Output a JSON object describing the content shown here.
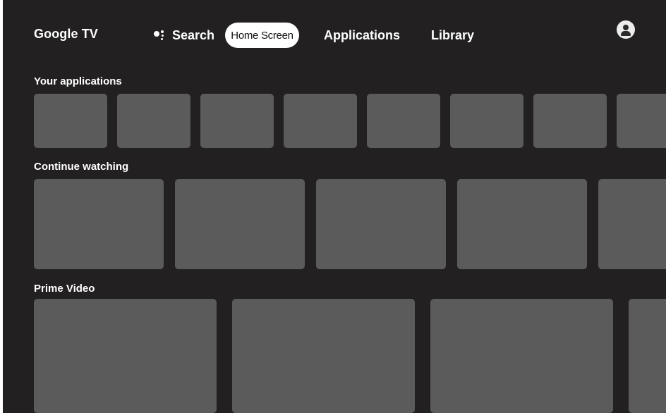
{
  "app": {
    "title": "Google TV"
  },
  "nav": {
    "search_label": "Search",
    "home_label": "Home Screen",
    "applications_label": "Applications",
    "library_label": "Library",
    "search_icon": "google-assistant-icon",
    "profile_icon": "account-icon"
  },
  "sections": {
    "apps": {
      "title": "Your applications",
      "tile_count": 8
    },
    "continue": {
      "title": "Continue watching",
      "tile_count": 5
    },
    "prime": {
      "title": "Prime Video",
      "tile_count": 4
    }
  },
  "colors": {
    "background": "#222021",
    "tile": "#5b5b5b",
    "selected_pill": "#ffffff",
    "text": "#ffffff"
  }
}
